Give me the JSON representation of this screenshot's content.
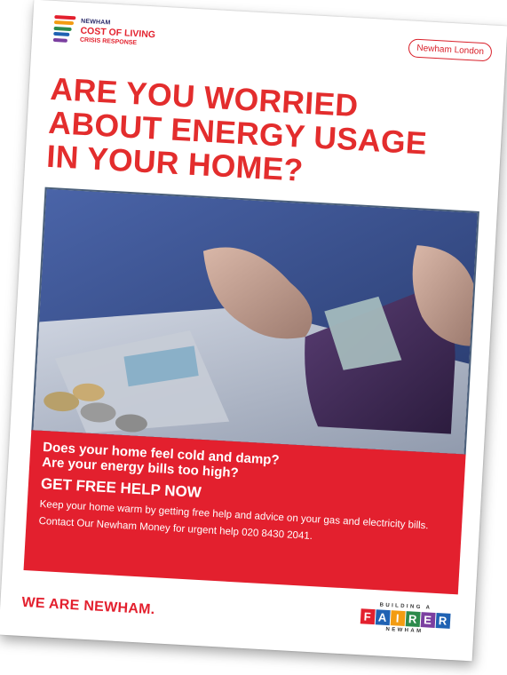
{
  "logo": {
    "line1": "NEWHAM",
    "line2": "COST OF LIVING",
    "line3": "CRISIS RESPONSE",
    "bar_colors": [
      "#e3202e",
      "#f39c12",
      "#2c8a4b",
      "#1f62b3",
      "#7b3fa0"
    ]
  },
  "badge": "Newham London",
  "headline": [
    "ARE YOU WORRIED",
    "ABOUT ENERGY USAGE",
    "IN YOUR HOME?"
  ],
  "panel": {
    "question1": "Does your home feel cold and damp?",
    "question2": "Are your energy bills too high?",
    "cta": "GET FREE HELP NOW",
    "body": "Keep your home warm by getting free help and advice on your gas and electricity bills.",
    "contact": "Contact Our Newham Money for urgent help 020 8430 2041."
  },
  "footer": {
    "slogan": "WE ARE NEWHAM.",
    "building": "BUILDING A",
    "fairer_letters": [
      "F",
      "A",
      "I",
      "R",
      "E",
      "R"
    ],
    "fairer_colors": [
      "#e3202e",
      "#1f62b3",
      "#f39c12",
      "#2c8a4b",
      "#7b3fa0",
      "#1f62b3"
    ],
    "newham": "NEWHAM"
  },
  "colors": {
    "accent_red": "#e3202e",
    "headline_red": "#e32d2d"
  }
}
